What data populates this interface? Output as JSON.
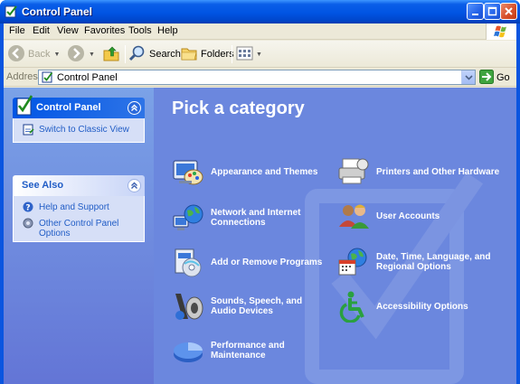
{
  "window": {
    "title": "Control Panel"
  },
  "menu": [
    "File",
    "Edit",
    "View",
    "Favorites",
    "Tools",
    "Help"
  ],
  "toolbar": {
    "back": "Back",
    "search": "Search",
    "folders": "Folders"
  },
  "address": {
    "label": "Address",
    "value": "Control Panel",
    "go": "Go"
  },
  "taskpane": {
    "control_panel": {
      "title": "Control Panel",
      "link": "Switch to Classic View"
    },
    "see_also": {
      "title": "See Also",
      "links": [
        "Help and Support",
        "Other Control Panel Options"
      ]
    }
  },
  "main": {
    "heading": "Pick a category",
    "categories": [
      "Appearance and Themes",
      "Printers and Other Hardware",
      "Network and Internet Connections",
      "User Accounts",
      "Add or Remove Programs",
      "Date, Time, Language, and Regional Options",
      "Sounds, Speech, and Audio Devices",
      "Accessibility Options",
      "Performance and Maintenance"
    ]
  }
}
